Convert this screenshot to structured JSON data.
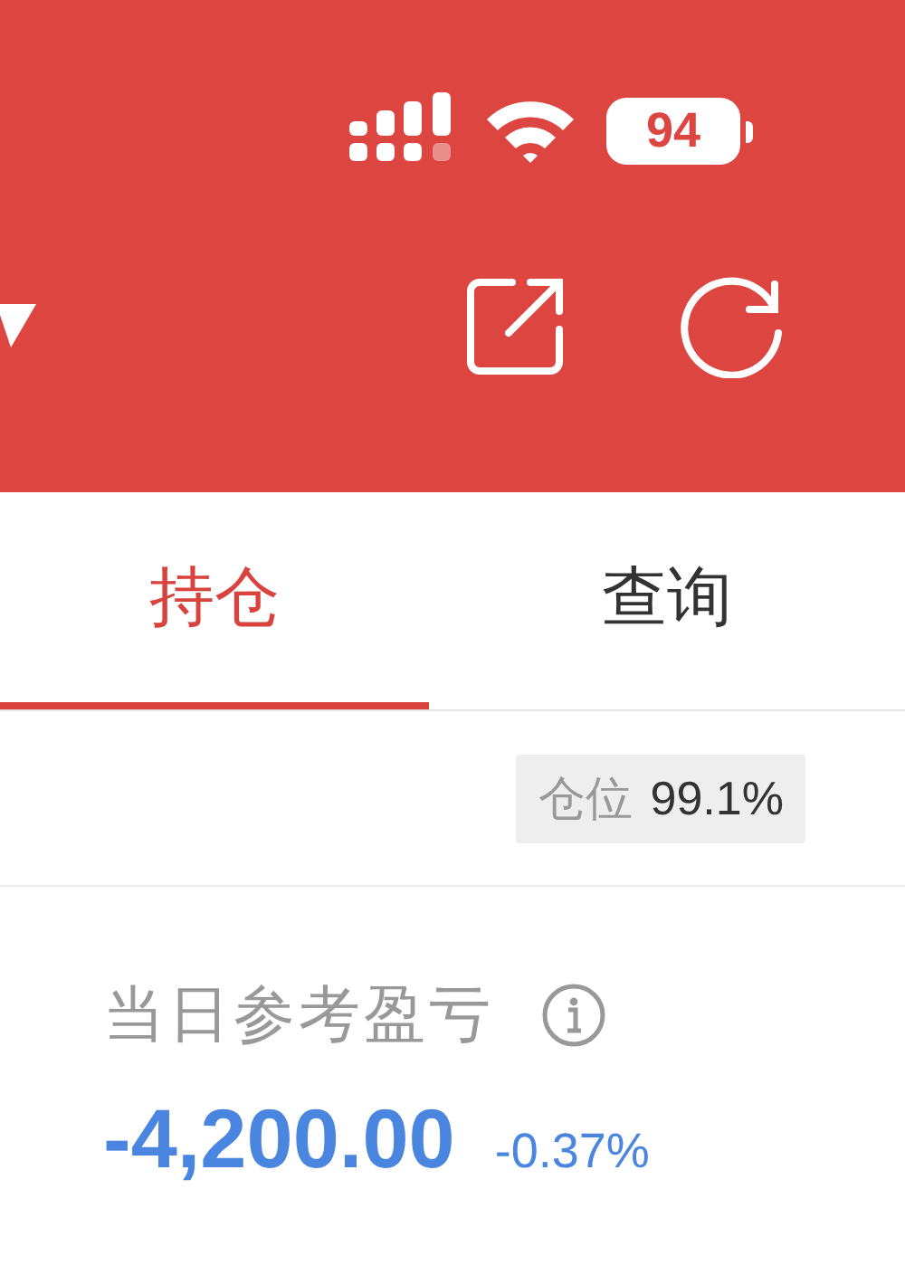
{
  "status_bar": {
    "battery": "94"
  },
  "tabs": [
    {
      "label": "持仓",
      "selected": true
    },
    {
      "label": "查询",
      "selected": false
    }
  ],
  "position": {
    "label": "仓位",
    "value": "99.1%"
  },
  "pnl": {
    "label": "当日参考盈亏",
    "value": "-4,200.00",
    "percent": "-0.37%"
  }
}
